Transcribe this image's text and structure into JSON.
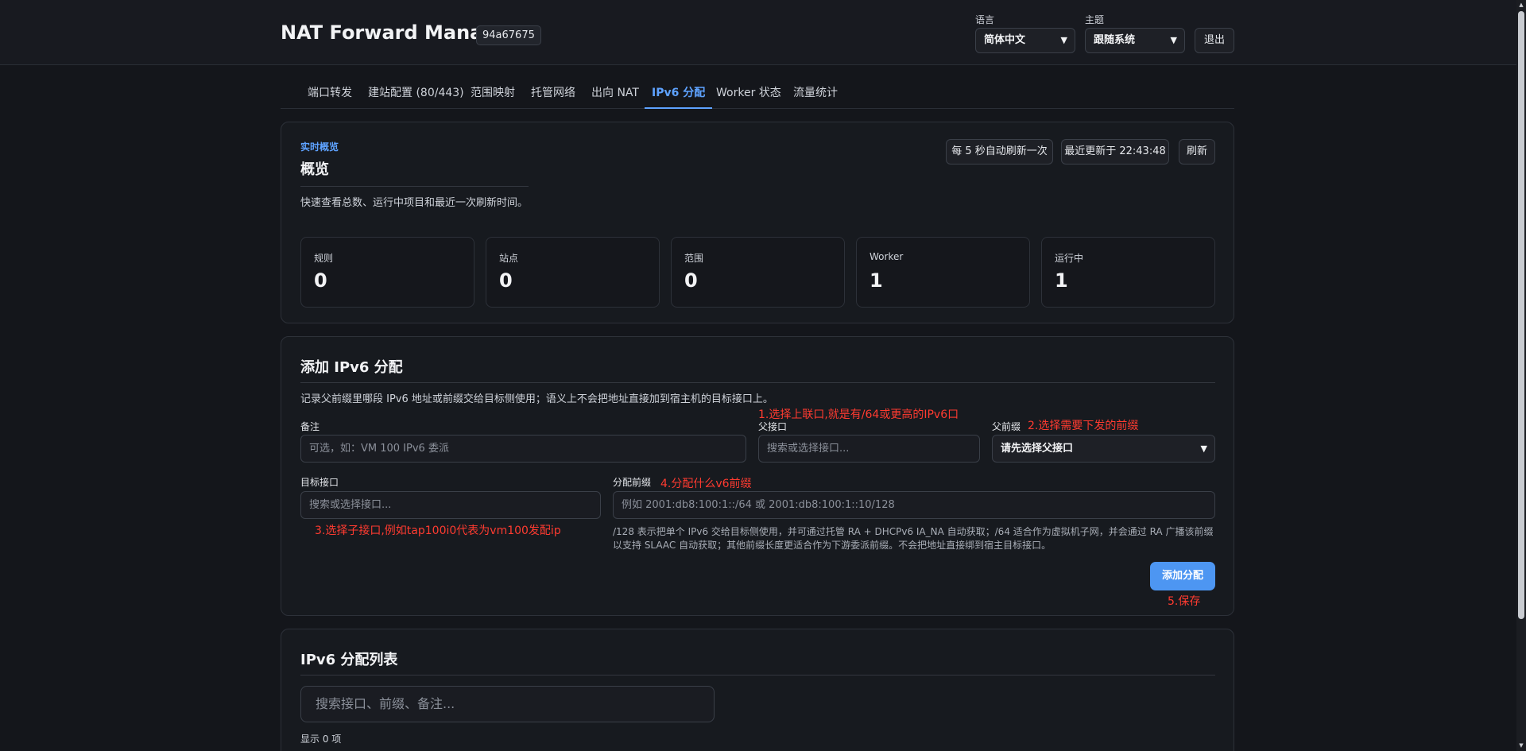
{
  "header": {
    "title": "NAT Forward Manager",
    "badge": "94a67675",
    "language_label": "语言",
    "language_value": "简体中文",
    "theme_label": "主题",
    "theme_value": "跟随系统",
    "logout_label": "退出"
  },
  "tabs": [
    {
      "label": "端口转发"
    },
    {
      "label": "建站配置 (80/443)"
    },
    {
      "label": "范围映射"
    },
    {
      "label": "托管网络"
    },
    {
      "label": "出向 NAT"
    },
    {
      "label": "IPv6 分配"
    },
    {
      "label": "Worker 状态"
    },
    {
      "label": "流量统计"
    }
  ],
  "active_tab": "IPv6 分配",
  "overview": {
    "eyebrow": "实时概览",
    "title": "概览",
    "subtitle": "快速查看总数、运行中项目和最近一次刷新时间。",
    "auto_refresh": "每 5 秒自动刷新一次",
    "last_updated": "最近更新于 22:43:48",
    "refresh_label": "刷新",
    "stats": [
      {
        "label": "规则",
        "value": "0"
      },
      {
        "label": "站点",
        "value": "0"
      },
      {
        "label": "范围",
        "value": "0"
      },
      {
        "label": "Worker",
        "value": "1"
      },
      {
        "label": "运行中",
        "value": "1"
      }
    ]
  },
  "add_form": {
    "title": "添加 IPv6 分配",
    "description": "记录父前缀里哪段 IPv6 地址或前缀交给目标侧使用；语义上不会把地址直接加到宿主机的目标接口上。",
    "remark_label": "备注",
    "remark_placeholder": "可选，如：VM 100 IPv6 委派",
    "parent_iface_label": "父接口",
    "parent_iface_placeholder": "搜索或选择接口...",
    "parent_prefix_label": "父前缀",
    "parent_prefix_value": "请先选择父接口",
    "target_iface_label": "目标接口",
    "target_iface_placeholder": "搜索或选择接口...",
    "assign_prefix_label": "分配前缀",
    "assign_prefix_placeholder": "例如 2001:db8:100:1::/64 或 2001:db8:100:1::10/128",
    "help_text": "/128 表示把单个 IPv6 交给目标侧使用，并可通过托管 RA + DHCPv6 IA_NA 自动获取；/64 适合作为虚拟机子网，并会通过 RA 广播该前缀以支持 SLAAC 自动获取；其他前缀长度更适合作为下游委派前缀。不会把地址直接绑到宿主目标接口。",
    "submit_label": "添加分配"
  },
  "annotations": {
    "note1": "1.选择上联口,就是有/64或更高的IPv6口",
    "note2": "2.选择需要下发的前缀",
    "note3": "3.选择子接口,例如tap100i0代表为vm100发配ip",
    "note4": "4.分配什么v6前缀",
    "note5": "5.保存"
  },
  "list": {
    "title": "IPv6 分配列表",
    "search_placeholder": "搜索接口、前缀、备注...",
    "count_text": "显示 0 项"
  }
}
